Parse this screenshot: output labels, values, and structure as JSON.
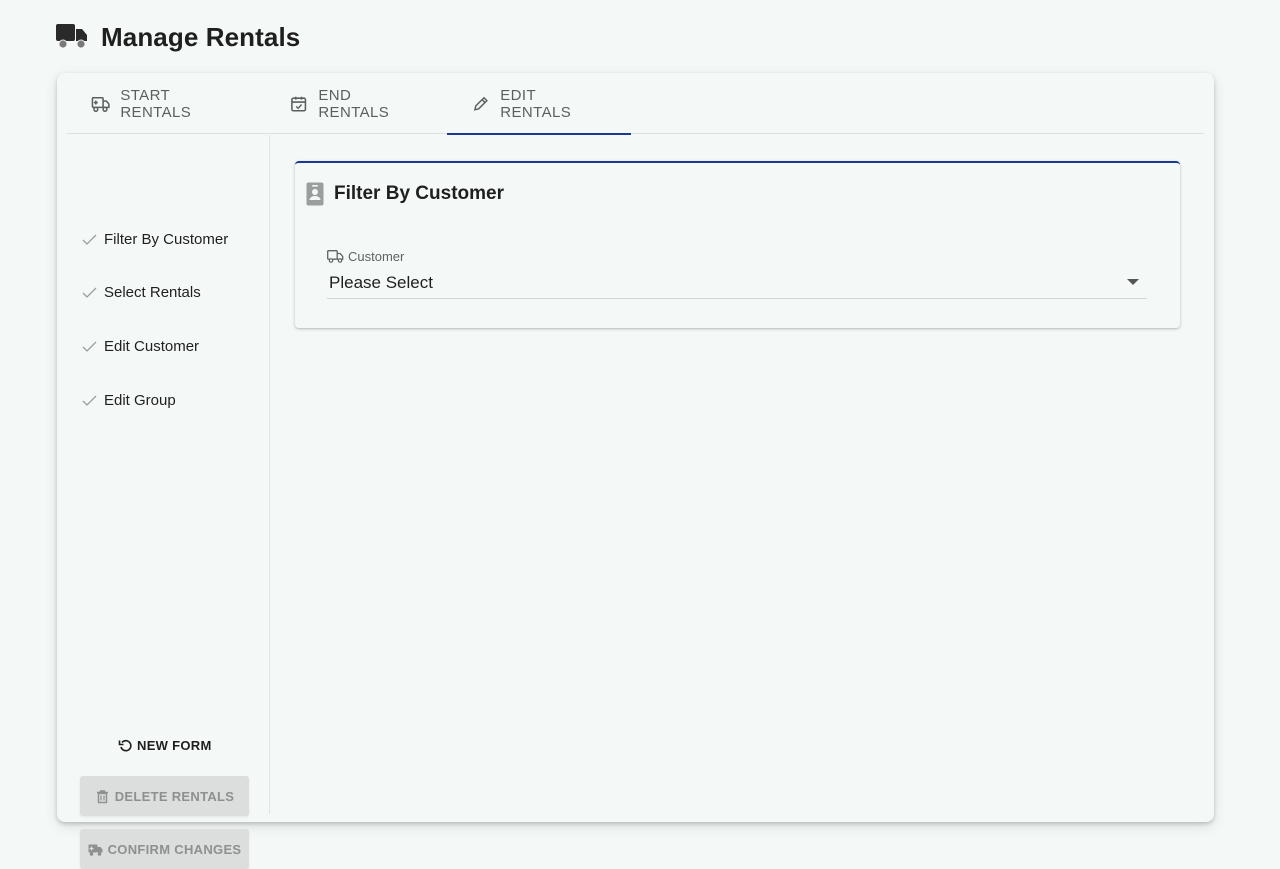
{
  "page": {
    "title": "Manage Rentals"
  },
  "tabs": [
    {
      "label": "START RENTALS",
      "icon": "truck-medical-icon"
    },
    {
      "label": "END RENTALS",
      "icon": "calendar-check-icon"
    },
    {
      "label": "EDIT RENTALS",
      "icon": "pencil-icon",
      "active": true
    }
  ],
  "steps": [
    {
      "label": "Filter By Customer"
    },
    {
      "label": "Select Rentals"
    },
    {
      "label": "Edit Customer"
    },
    {
      "label": "Edit Group"
    }
  ],
  "actions": {
    "new_form": "NEW FORM",
    "delete": "DELETE RENTALS",
    "confirm": "CONFIRM CHANGES"
  },
  "panel": {
    "title": "Filter By Customer",
    "customer_label": "Customer",
    "customer_value": "Please Select"
  },
  "colors": {
    "accent": "#1b3a8f",
    "background": "#f4f8f7",
    "disabled": "#dcdedd"
  }
}
